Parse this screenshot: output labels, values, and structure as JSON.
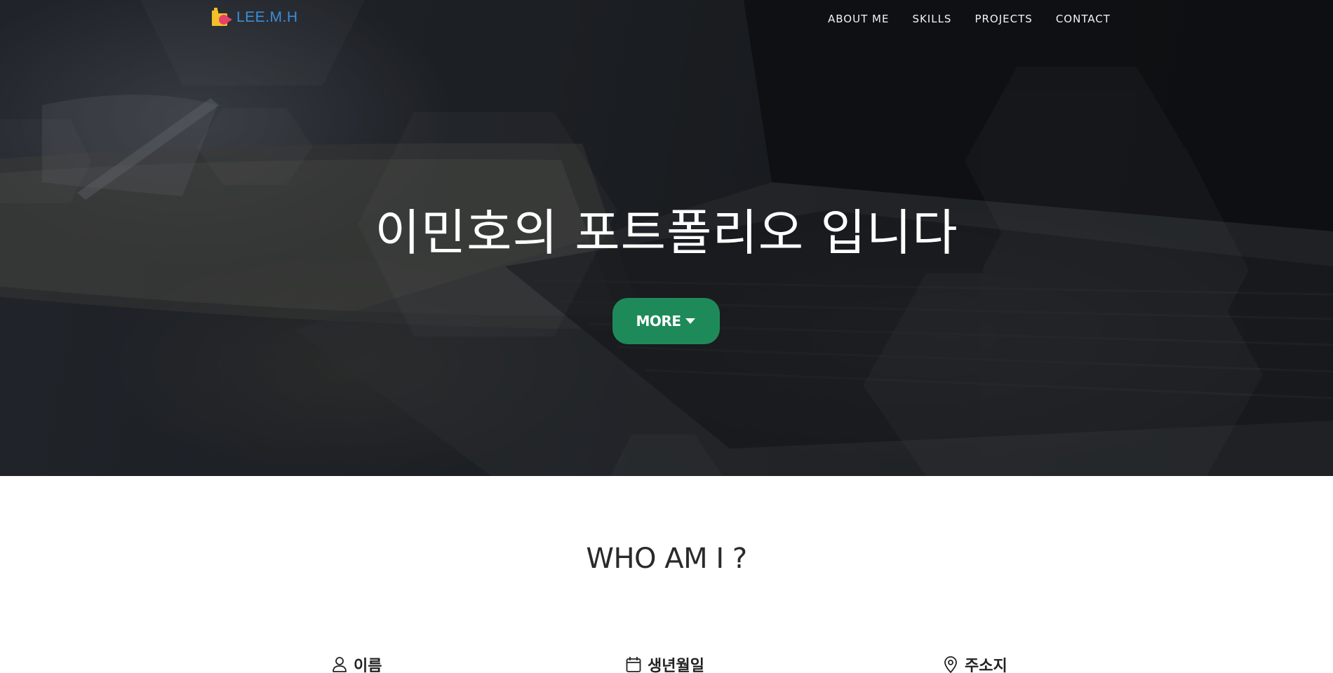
{
  "nav": {
    "brand": "LEE.M.H",
    "links": [
      "ABOUT ME",
      "SKILLS",
      "PROJECTS",
      "CONTACT"
    ]
  },
  "hero": {
    "title": "이민호의 포트폴리오 입니다",
    "more_button": "MORE"
  },
  "about": {
    "heading": "WHO AM I ?",
    "items": [
      {
        "label": "이름",
        "icon": "person-icon"
      },
      {
        "label": "생년월일",
        "icon": "calendar-icon"
      },
      {
        "label": "주소지",
        "icon": "location-pin-icon"
      }
    ]
  },
  "colors": {
    "brand_blue": "#3b8ed8",
    "button_green": "#1e8a5a",
    "hero_dark": "#1c1e22"
  }
}
